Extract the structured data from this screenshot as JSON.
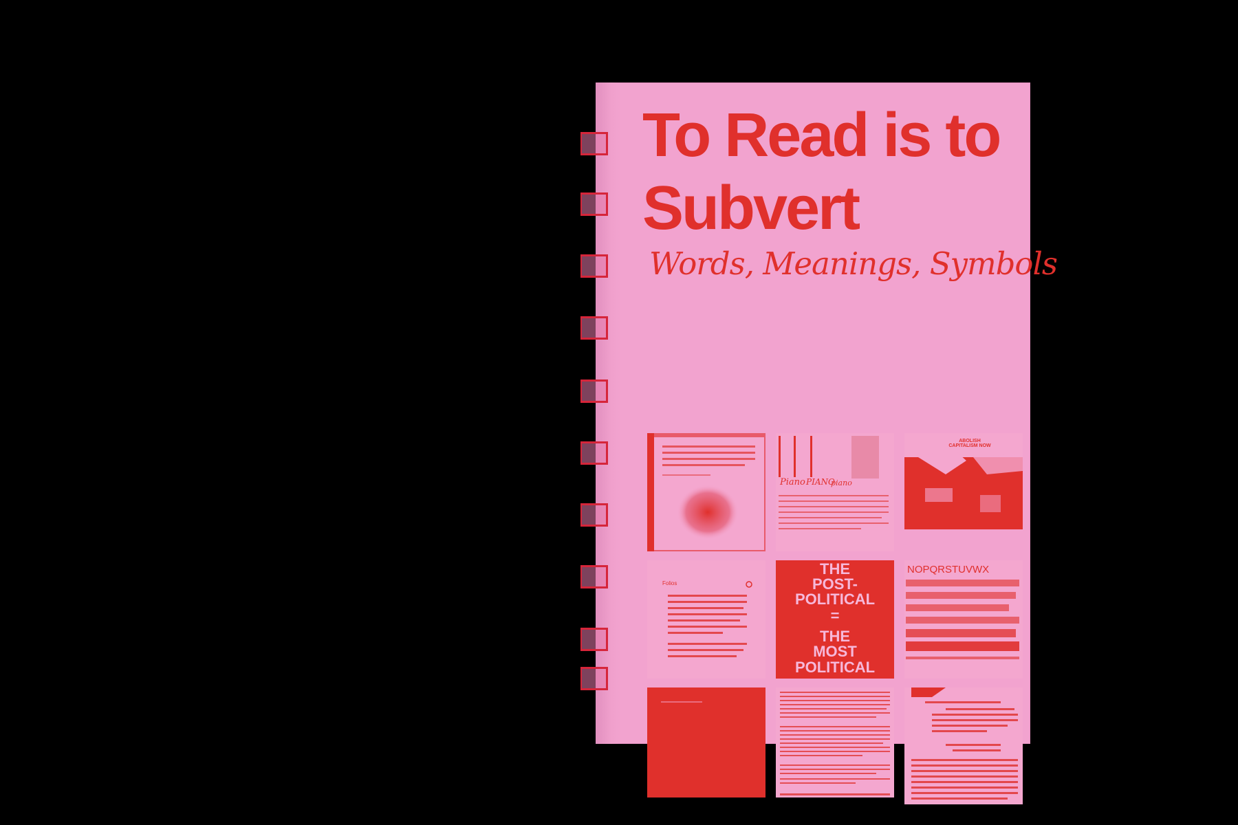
{
  "cover": {
    "title": "To Read is to Subvert",
    "subtitle": "Words, Meanings, Symbols"
  },
  "thumbnails": {
    "poster_lines": [
      "THE",
      "POST-",
      "POLITICAL",
      "=",
      "THE",
      "MOST",
      "POLITICAL"
    ],
    "sticker_text": "ABOLISH CAPITALISM NOW",
    "alphabet_line": "NOPQRSTUVWX",
    "handwriting": [
      "Piano",
      "PIANO",
      "piano"
    ],
    "phone_back": "Folios"
  },
  "colors": {
    "background": "#000000",
    "paper": "#f2a3cf",
    "ink": "#e0302c",
    "thread": "#d6253a"
  }
}
